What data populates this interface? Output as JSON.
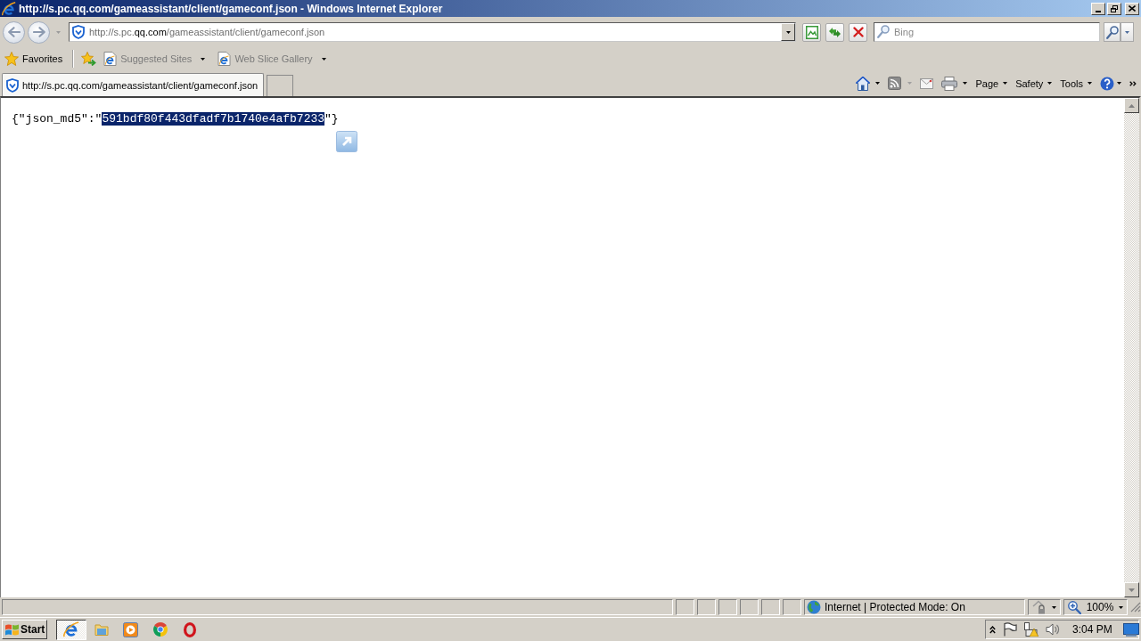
{
  "window": {
    "title": "http://s.pc.qq.com/gameassistant/client/gameconf.json - Windows Internet Explorer"
  },
  "address_bar": {
    "address": [
      {
        "text": "http://s.pc.",
        "highlighted": false
      },
      {
        "text": "qq.com",
        "highlighted": true
      },
      {
        "text": "/gameassistant/client/gameconf.json",
        "highlighted": false
      }
    ]
  },
  "search": {
    "placeholder": "Bing"
  },
  "favorites_bar": {
    "favorites": "Favorites",
    "items": [
      {
        "label": "Suggested Sites"
      },
      {
        "label": "Web Slice Gallery"
      }
    ]
  },
  "tabs": [
    {
      "label": "http://s.pc.qq.com/gameassistant/client/gameconf.json",
      "selected": true
    }
  ],
  "command_bar": {
    "menus": [
      "Page",
      "Safety",
      "Tools"
    ]
  },
  "document": {
    "parts": [
      {
        "text": "{\"json_md5\":\"",
        "selected": false
      },
      {
        "text": "591bdf80f443dfadf7b1740e4afb7233",
        "selected": true
      },
      {
        "text": "\"}",
        "selected": false
      }
    ]
  },
  "status_bar": {
    "zone": "Internet | Protected Mode: On",
    "zoom": "100%"
  },
  "taskbar": {
    "start": "Start",
    "buttons": [
      {
        "kind": "internet_explorer",
        "selected": true
      },
      {
        "kind": "explorer",
        "selected": false
      },
      {
        "kind": "media_player",
        "selected": false
      },
      {
        "kind": "chrome",
        "selected": false
      },
      {
        "kind": "opera",
        "selected": false
      }
    ]
  },
  "tray": {
    "time": "3:04 PM"
  }
}
